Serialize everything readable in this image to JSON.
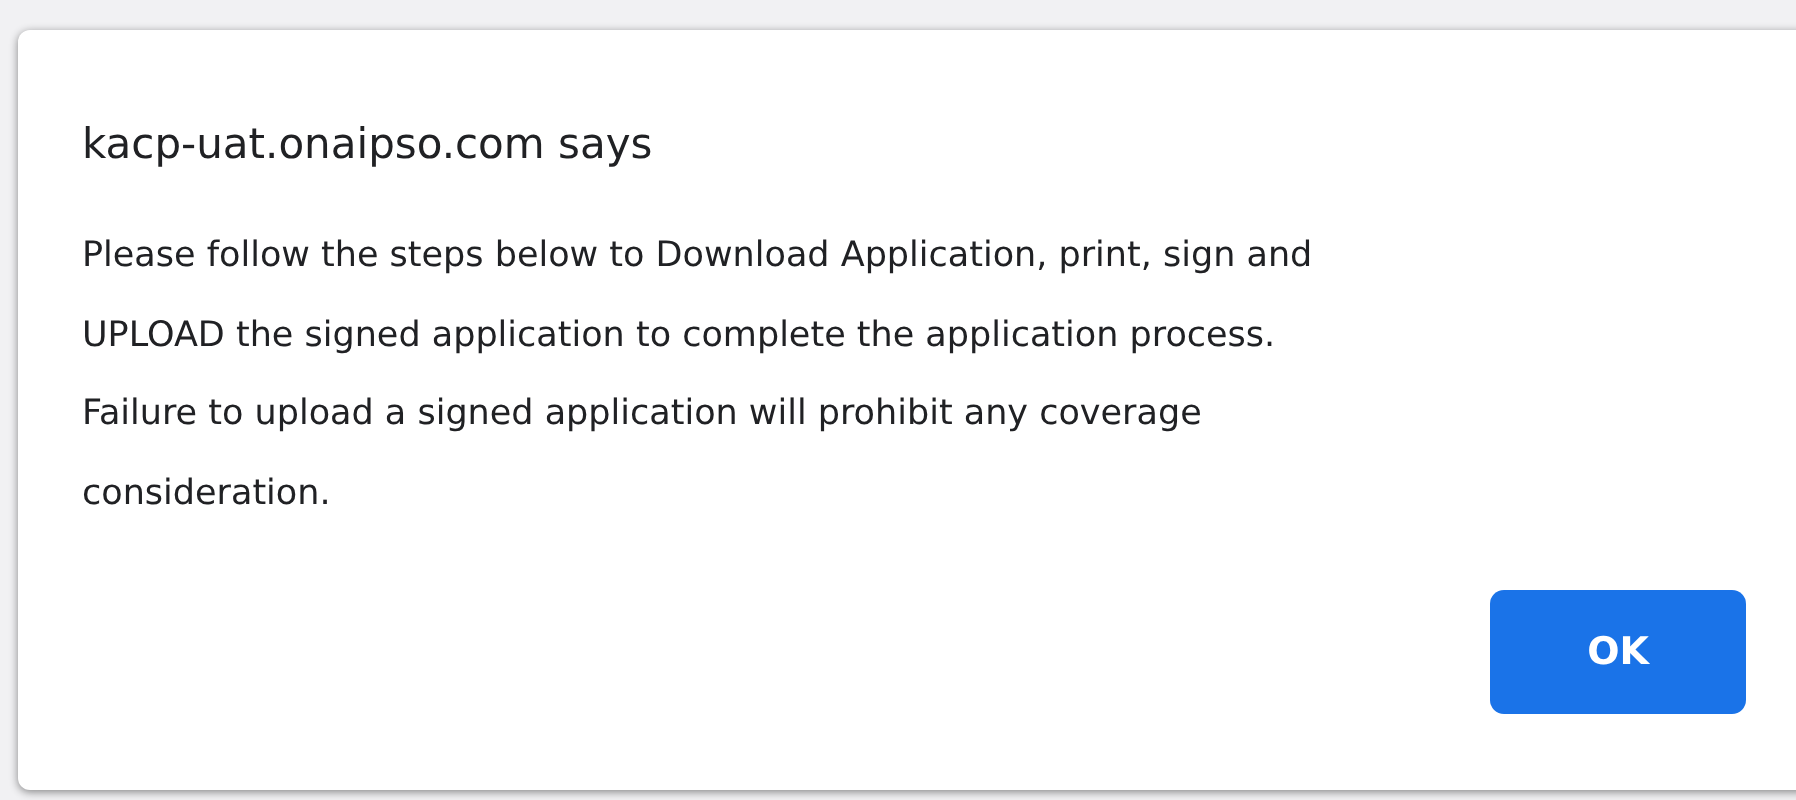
{
  "dialog": {
    "title": "kacp-uat.onaipso.com says",
    "message": [
      "Please follow the steps below to Download Application, print, sign and",
      "UPLOAD the signed application to complete the application process.",
      "Failure to upload a signed application will prohibit any coverage",
      "consideration."
    ],
    "buttons": [
      {
        "label": "OK"
      }
    ]
  }
}
